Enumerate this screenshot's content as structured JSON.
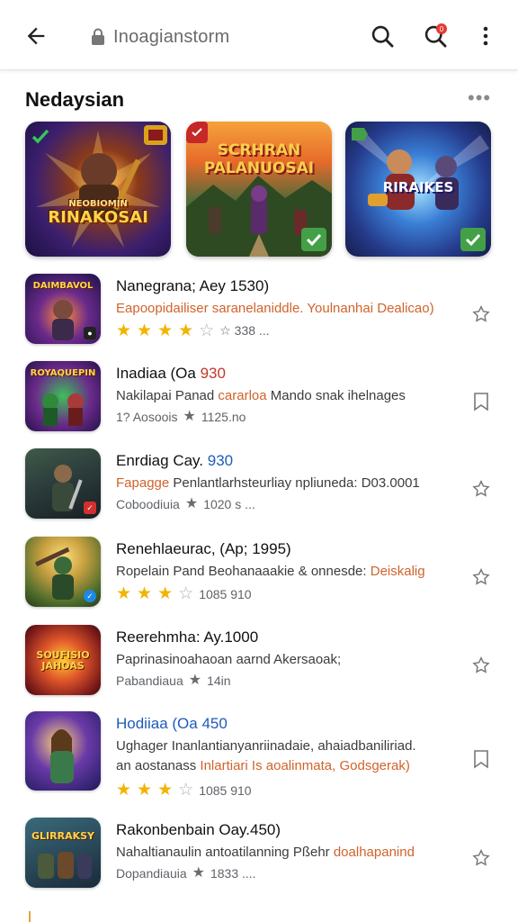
{
  "topbar": {
    "url": "Inoagianstorm",
    "icons": [
      "back-arrow-icon",
      "lock-icon",
      "search-icon",
      "notification-search-icon",
      "more-vertical-icon"
    ],
    "badge": "0"
  },
  "section": {
    "title": "Nedaysian",
    "more": "•••"
  },
  "featured": [
    {
      "art_title": "RINAKOSAI",
      "art_sub": "NEOBIOMIN",
      "corner": "check-badge-icon"
    },
    {
      "art_title": "SCRHRAN PALANUOSAI",
      "art_sub": "",
      "corner": "check-badge-icon"
    },
    {
      "art_title": "RIRAIKES",
      "art_sub": "",
      "corner": "check-badge-icon"
    }
  ],
  "items": [
    {
      "title": "Nanegrana; Aey 1530)",
      "title_accent": "",
      "desc": "Eapoopidailiser saranelaniddle. ",
      "desc_hl": "Youlnanhai Dealicao)",
      "meta": "☆ 338 ...",
      "rating": 3.5,
      "thumb_label": "DAIMBAVOL",
      "action": "star-outline-icon"
    },
    {
      "title": "Inadiaa (Oa ",
      "title_accent": "930",
      "desc": "Nakilapai Panad ",
      "desc_hl": "cararloa",
      "desc_tail": " Mando snak ihelnages",
      "meta_left": "1? Aosoois",
      "meta": "1125.no",
      "thumb_label": "ROYAQUEPIN",
      "action": "bookmark-outline-icon"
    },
    {
      "title": "Enrdiag Cay. ",
      "title_accent": "930",
      "desc": "Fapagge ",
      "desc_hl": "Penlantlarhsteurliay",
      "desc_tail": " npliuneda: D03.0001",
      "meta_left": "Coboodiuia",
      "meta": "1020 s ...",
      "thumb_label": "",
      "action": "star-outline-icon"
    },
    {
      "title": "Renehlaeurac, (Ap; 1995)",
      "title_accent": "",
      "desc": "Ropelain Pand Beohanaaakie & onnesde: ",
      "desc_hl": "Deiskalig",
      "meta": "1085 910",
      "rating": 3,
      "thumb_label": "",
      "action": "star-outline-icon"
    },
    {
      "title": "Reerehmha: Ay.1000",
      "title_accent": "",
      "desc": "Paprinasinoahaoan aarnd Akersaoak;",
      "desc_hl": "",
      "meta_left": "Pabandiaua",
      "meta": "14in",
      "thumb_label": "SOUFISIO JAHOAS",
      "action": "star-outline-icon"
    },
    {
      "title": "Hodiiaa (Oa ",
      "title_accent": "450",
      "desc": "Ughager Inanlantianyanriinadaie, ahaiadbaniliriad.",
      "desc2": "an aostanass ",
      "desc2_hl": "Inlartiari Is aoalinmata, Godsgerak)",
      "meta": "1085 910",
      "rating": 3,
      "thumb_label": "",
      "action": "bookmark-outline-icon"
    },
    {
      "title": "Rakonbenbain Oay.450)",
      "title_accent": "",
      "desc": "Nahaltianaulin antoatilanning Pßehr ",
      "desc_hl": "doalhapanind",
      "meta_left": "Dopandiauia",
      "meta": "1833 ....",
      "thumb_label": "GLIRRAKSY",
      "action": "star-outline-icon"
    }
  ],
  "colors": {
    "accent_star": "#f2b400",
    "highlight_orange": "#d0632b",
    "title_blue": "#1e5bb8",
    "badge_red": "#e53935"
  }
}
